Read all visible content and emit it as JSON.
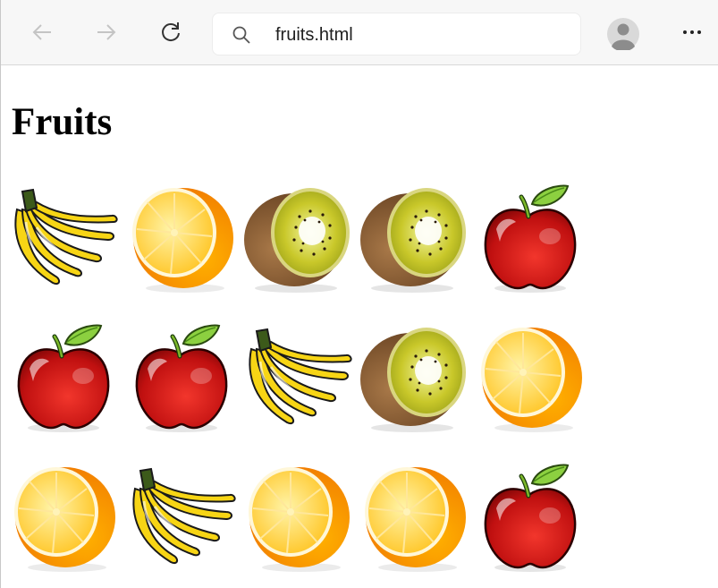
{
  "browser": {
    "address": "fruits.html",
    "nav_icons": [
      "back-arrow-icon",
      "forward-arrow-icon",
      "reload-icon"
    ],
    "profile_icon": "profile-avatar-icon",
    "menu_icon": "more-options-icon"
  },
  "page": {
    "heading": "Fruits",
    "grid": [
      [
        "banana",
        "orange",
        "kiwi",
        "kiwi",
        "apple"
      ],
      [
        "apple",
        "apple",
        "banana",
        "kiwi",
        "orange"
      ],
      [
        "orange",
        "banana",
        "orange",
        "orange",
        "apple"
      ]
    ]
  }
}
